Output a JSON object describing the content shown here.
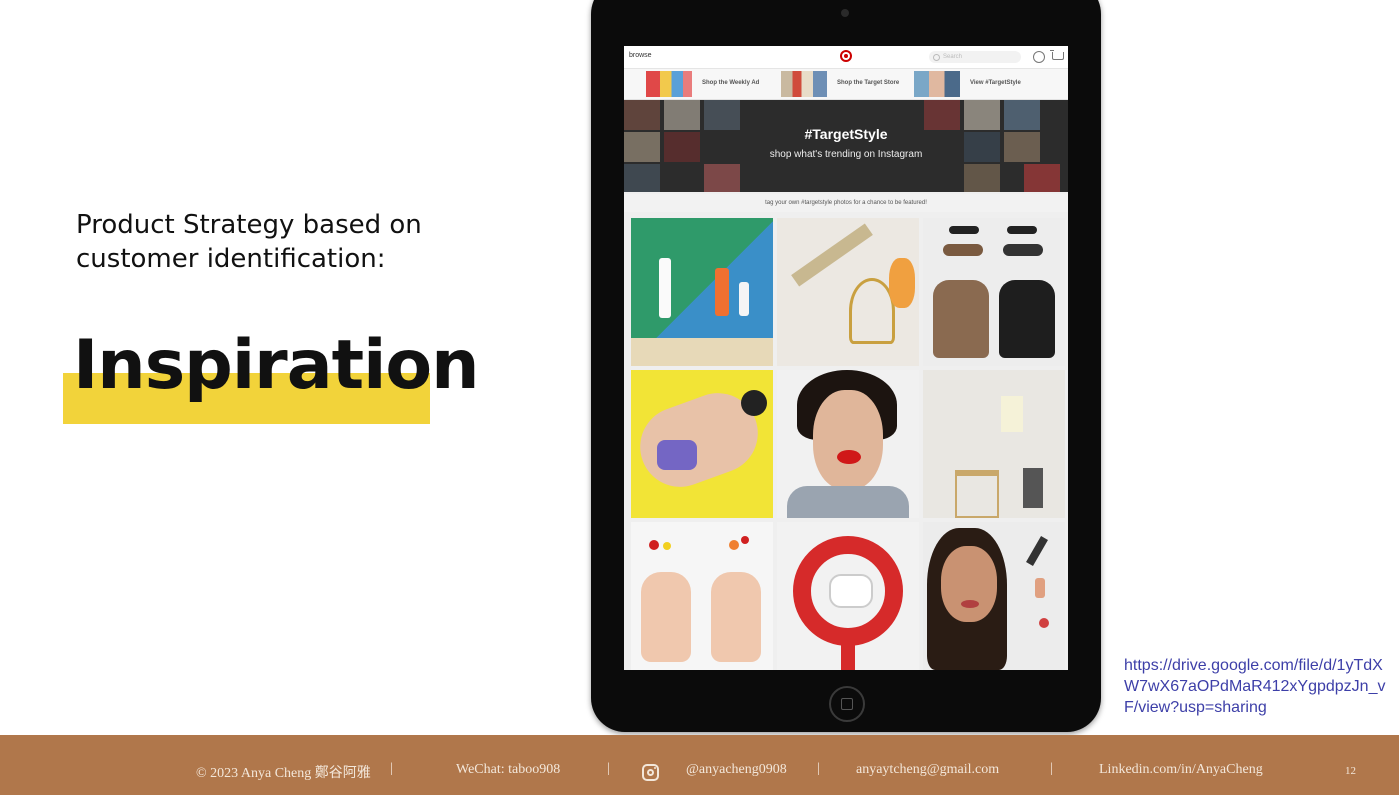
{
  "slide": {
    "subtitle": "Product Strategy based on customer identification:",
    "headline": "Inspiration",
    "link": "https://drive.google.com/file/d/1yTdXW7wX67aOPdMaR412xYgpdpzJn_vF/view?usp=sharing",
    "colors": {
      "highlight": "#f2d33a",
      "footer": "#b0774b",
      "link": "#3d3fa8"
    }
  },
  "tablet_screen": {
    "nav_label": "browse",
    "search_placeholder": "Search",
    "icons": [
      "target-logo-icon",
      "search-icon",
      "account-icon",
      "cart-icon"
    ],
    "promos": [
      {
        "label": "Shop the Weekly Ad"
      },
      {
        "label": "Shop the Target Store"
      },
      {
        "label": "View #TargetStyle"
      }
    ],
    "hero_title": "#TargetStyle",
    "hero_subtitle": "shop what's trending on Instagram",
    "tagline": "tag your own #targetstyle photos for a chance to be featured!",
    "grid_photos": [
      "beauty-products-before-after",
      "craft-supplies-scissors",
      "sunglasses-shoes-backpacks",
      "swimsuit-pool-float",
      "red-lips-portrait",
      "bathroom-interior",
      "nail-polish-hands",
      "target-bullseye-sneakers",
      "model-with-makeup"
    ]
  },
  "footer": {
    "copyright": "© 2023 Anya Cheng 鄭谷阿雅",
    "wechat": "WeChat: taboo908",
    "instagram": "@anyacheng0908",
    "email": "anyaytcheng@gmail.com",
    "linkedin": "Linkedin.com/in/AnyaCheng",
    "page_number": "12"
  }
}
